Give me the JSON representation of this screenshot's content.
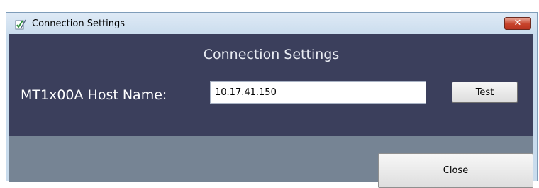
{
  "window": {
    "title": "Connection Settings",
    "close_glyph": "✕"
  },
  "dialog": {
    "heading": "Connection Settings",
    "host_label": "MT1x00A Host Name:",
    "host_value": "10.17.41.150",
    "test_label": "Test",
    "close_label": "Close"
  },
  "colors": {
    "panel_top": "#3b3f5c",
    "panel_bottom": "#768494",
    "close_red": "#c7432b"
  },
  "icons": {
    "app": "checklist-pencil-icon",
    "window_close": "close-icon"
  }
}
